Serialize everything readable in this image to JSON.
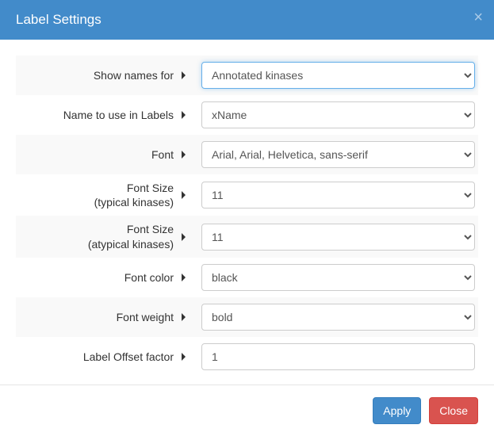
{
  "header": {
    "title": "Label Settings",
    "close_x": "×"
  },
  "rows": [
    {
      "label": "Show names for",
      "type": "select",
      "value": "Annotated kinases",
      "focused": true
    },
    {
      "label": "Name to use in Labels",
      "type": "select",
      "value": "xName"
    },
    {
      "label": "Font",
      "type": "select",
      "value": "Arial, Arial, Helvetica, sans-serif"
    },
    {
      "label": "Font Size\n(typical kinases)",
      "type": "select",
      "value": "11"
    },
    {
      "label": "Font Size\n(atypical kinases)",
      "type": "select",
      "value": "11"
    },
    {
      "label": "Font color",
      "type": "select",
      "value": "black"
    },
    {
      "label": "Font weight",
      "type": "select",
      "value": "bold"
    },
    {
      "label": "Label Offset factor",
      "type": "text",
      "value": "1"
    }
  ],
  "footer": {
    "apply": "Apply",
    "close": "Close"
  }
}
